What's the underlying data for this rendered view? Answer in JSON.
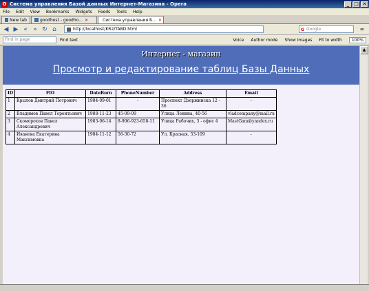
{
  "window": {
    "title": "Система управления Базой данных Интернет-Магазина - Opera",
    "controls": {
      "minimize": "_",
      "maximize": "□",
      "close": "✕"
    }
  },
  "menu": [
    "File",
    "Edit",
    "View",
    "Bookmarks",
    "Widgets",
    "Feeds",
    "Tools",
    "Help"
  ],
  "tabs": [
    {
      "label": "New tab",
      "active": false
    },
    {
      "label": "goodhost - goodho...",
      "active": false
    },
    {
      "label": "Система управления Б...",
      "active": true
    }
  ],
  "address": {
    "url": "http://localhost/KR2/TABD.html"
  },
  "search": {
    "placeholder": "Google"
  },
  "find": {
    "placeholder": "Find in page",
    "button": "Find text"
  },
  "toolbar": {
    "voice": "Voice",
    "author_mode": "Author mode",
    "show_images": "Show images",
    "fit_width": "Fit to width",
    "zoom": "100%"
  },
  "page": {
    "heading": "Интернет - магазин",
    "subheading": "Просмотр и редактирование таблиц Базы Данных"
  },
  "table": {
    "columns": [
      "ID",
      "FIO",
      "DateBorn",
      "PhoneNumber",
      "Address",
      "Email"
    ],
    "rows": [
      [
        "1",
        "Крылов Дмитрий Петрович",
        "1984-09-01",
        "-",
        "Проспект Дзержинска 12 - 36",
        "-"
      ],
      [
        "2",
        "Владимов Павел Терентьевич",
        "1988-11-23",
        "45-09-09",
        "Улица Ленина, 40-56",
        "vladcompany@mail.ru"
      ],
      [
        "3",
        "Скоморохов Павел Александрович",
        "1983-06-14",
        "8-906-923-658-11",
        "Улица Рабочих, 3 - офис 4",
        "MastGam@yandex.ru"
      ],
      [
        "4",
        "Иванова Екатерина Максимовна",
        "1984-11-12",
        "56-30-72",
        "Ул. Красная, 53-109",
        "-"
      ]
    ]
  },
  "icons": {
    "search": "google-g-icon",
    "back": "back-arrow-icon",
    "forward": "forward-arrow-icon",
    "reload": "reload-icon",
    "home": "home-icon"
  }
}
